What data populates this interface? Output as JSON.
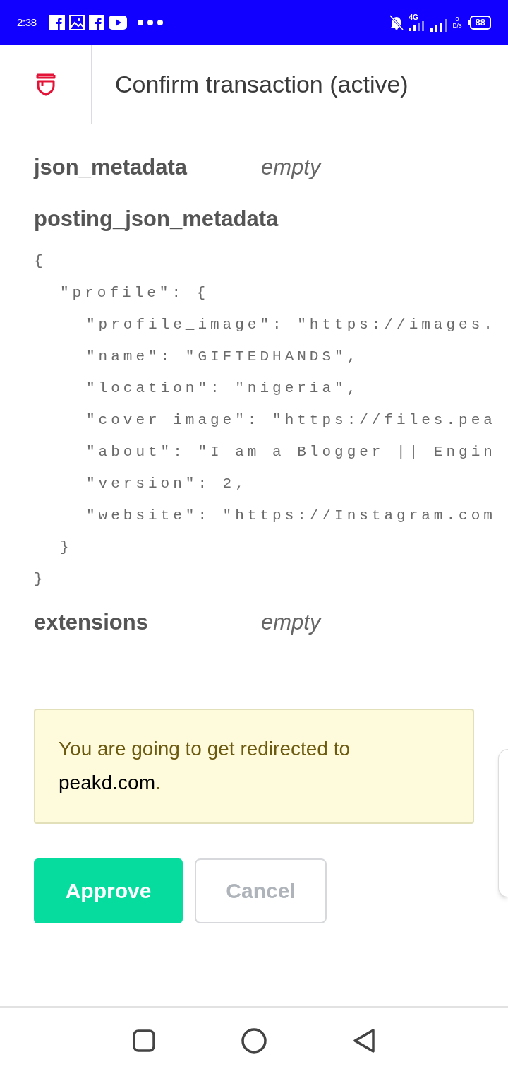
{
  "status_bar": {
    "time": "2:38",
    "network": "4G",
    "speed_value": "0",
    "speed_unit": "B/s",
    "battery": "88"
  },
  "header": {
    "title": "Confirm transaction (active)"
  },
  "fields": [
    {
      "label": "json_metadata",
      "value": "empty"
    },
    {
      "label": "posting_json_metadata"
    }
  ],
  "code_lines": [
    {
      "text": "{",
      "children": [
        {
          "text": "\"profile\": {",
          "children": [
            {
              "text": "\"profile_image\": \"https://images."
            },
            {
              "text": "\"name\": \"GIFTEDHANDS\","
            },
            {
              "text": "\"location\": \"nigeria\","
            },
            {
              "text": "\"cover_image\": \"https://files.pea"
            },
            {
              "text": "\"about\": \"I am a Blogger || Engin"
            },
            {
              "text": "\"version\": 2,"
            },
            {
              "text": "\"website\": \"https://Instagram.com"
            }
          ]
        },
        {
          "text": "}"
        }
      ]
    },
    {
      "text": "}"
    }
  ],
  "extensions": {
    "label": "extensions",
    "value": "empty"
  },
  "notice": {
    "prefix": "You are going to get redirected to",
    "domain": "peakd.com",
    "suffix": "."
  },
  "buttons": [
    {
      "label": "Approve",
      "kind": "primary"
    },
    {
      "label": "Cancel",
      "kind": "secondary"
    }
  ]
}
